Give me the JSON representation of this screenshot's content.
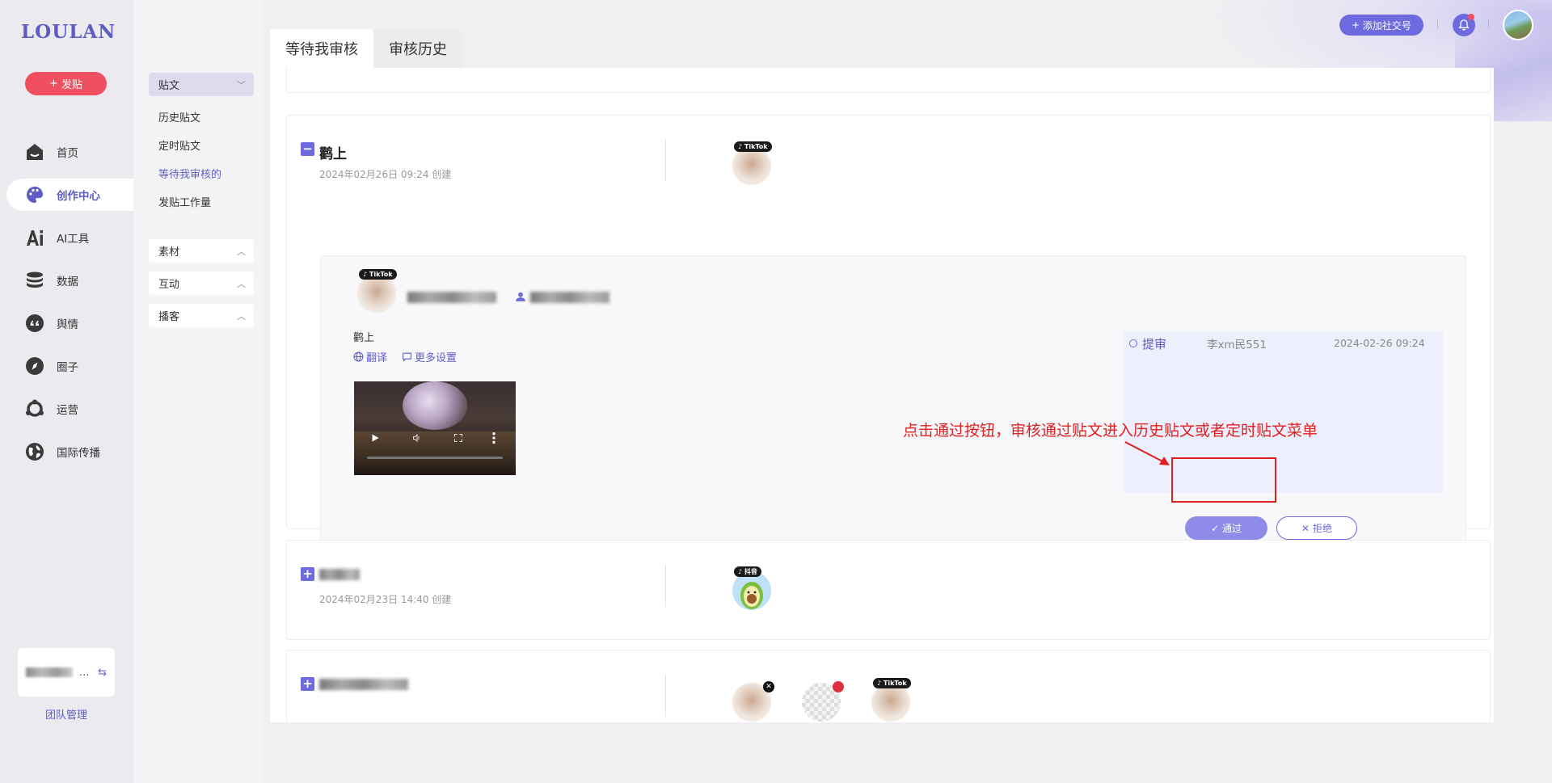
{
  "brand": {
    "logo": "LOULAN"
  },
  "nav": {
    "post_button": "发贴",
    "items": [
      {
        "label": "首页",
        "icon": "home-icon"
      },
      {
        "label": "创作中心",
        "icon": "palette-icon",
        "active": true
      },
      {
        "label": "AI工具",
        "icon": "ai-icon"
      },
      {
        "label": "数据",
        "icon": "database-icon"
      },
      {
        "label": "舆情",
        "icon": "quote-icon"
      },
      {
        "label": "圈子",
        "icon": "compass-icon"
      },
      {
        "label": "运营",
        "icon": "network-icon"
      },
      {
        "label": "国际传播",
        "icon": "globe-icon"
      }
    ],
    "team_name_suffix": "...",
    "team_link": "团队管理"
  },
  "submenu": {
    "sections": [
      {
        "label": "贴文",
        "open": true
      },
      {
        "label": "素材",
        "open": false
      },
      {
        "label": "互动",
        "open": false
      },
      {
        "label": "播客",
        "open": false
      }
    ],
    "post_items": [
      "历史贴文",
      "定时贴文",
      "等待我审核的",
      "发贴工作量"
    ],
    "active_item": "等待我审核的"
  },
  "header": {
    "add_social": "添加社交号"
  },
  "tabs": [
    "等待我审核",
    "审核历史"
  ],
  "posts": [
    {
      "title": "鹳上",
      "date": "2024年02月26日 09:24 创建",
      "platform_badge": "TikTok",
      "expanded": true,
      "detail": {
        "account_badge": "TikTok",
        "content": "鹳上",
        "translate": "翻译",
        "more_settings": "更多设置",
        "audit_log": {
          "action": "提审",
          "user": "李xm民551",
          "time": "2024-02-26 09:24"
        },
        "approve_label": "通过",
        "reject_label": "拒绝"
      }
    },
    {
      "date": "2024年02月23日 14:40 创建",
      "platform_badge": "抖音",
      "expanded": false
    },
    {
      "expanded": false,
      "platform_badge": "TikTok"
    }
  ],
  "annotation": "点击通过按钮，审核通过贴文进入历史贴文或者定时贴文菜单",
  "colors": {
    "accent": "#6d6ae0",
    "brand": "#5e5cc4",
    "danger": "#ef4f5f",
    "annotation": "#e02020"
  }
}
